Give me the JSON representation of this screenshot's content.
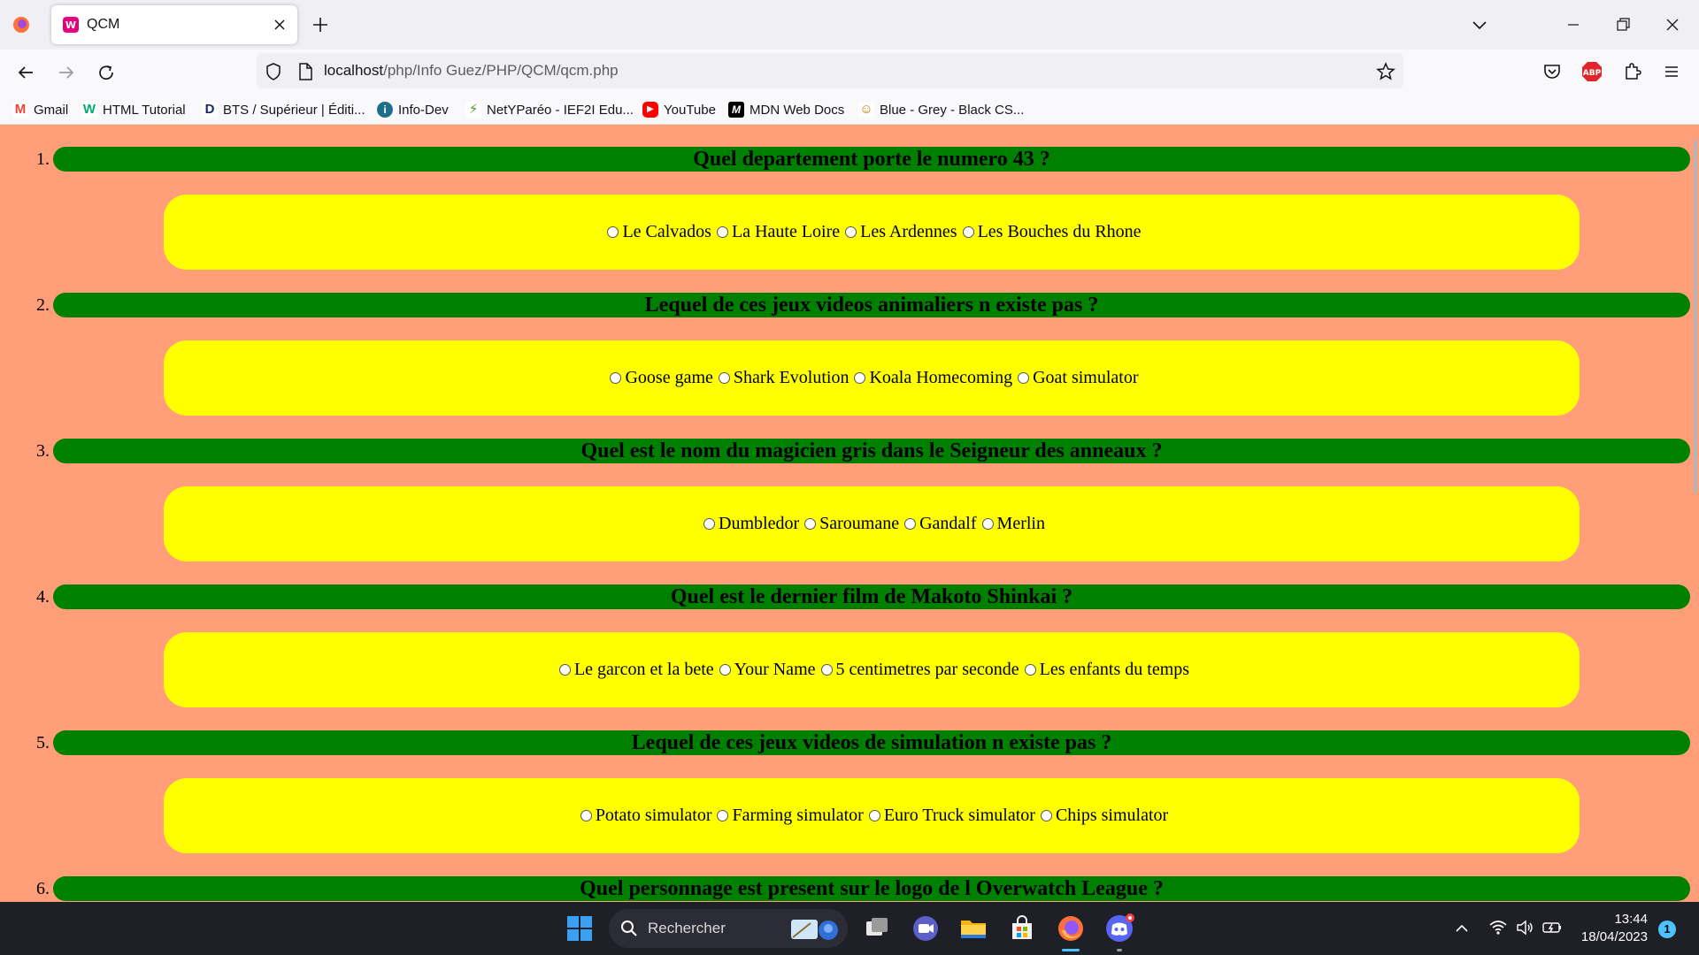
{
  "browser": {
    "tab_title": "QCM",
    "url_host": "localhost",
    "url_path": "/php/Info Guez/PHP/QCM/qcm.php",
    "bookmarks": [
      {
        "label": "Gmail",
        "icon": "gmail-icon"
      },
      {
        "label": "HTML Tutorial",
        "icon": "w3schools-icon"
      },
      {
        "label": "BTS / Supérieur | Éditi...",
        "icon": "d-logo-icon"
      },
      {
        "label": "Info-Dev",
        "icon": "info-dev-icon"
      },
      {
        "label": "NetYParéo - IEF2I Edu...",
        "icon": "netypareo-icon"
      },
      {
        "label": "YouTube",
        "icon": "youtube-icon"
      },
      {
        "label": "MDN Web Docs",
        "icon": "mdn-icon"
      },
      {
        "label": "Blue - Grey - Black CS...",
        "icon": "blue-grey-icon"
      }
    ]
  },
  "quiz": {
    "questions": [
      {
        "number": "1.",
        "text": "Quel departement porte le numero 43 ?",
        "options": [
          "Le Calvados",
          "La Haute Loire",
          "Les Ardennes",
          "Les Bouches du Rhone"
        ]
      },
      {
        "number": "2.",
        "text": "Lequel de ces jeux videos animaliers n existe pas ?",
        "options": [
          "Goose game",
          "Shark Evolution",
          "Koala Homecoming",
          "Goat simulator"
        ]
      },
      {
        "number": "3.",
        "text": "Quel est le nom du magicien gris dans le Seigneur des anneaux ?",
        "options": [
          "Dumbledor",
          "Saroumane",
          "Gandalf",
          "Merlin"
        ]
      },
      {
        "number": "4.",
        "text": "Quel est le dernier film de Makoto Shinkai ?",
        "options": [
          "Le garcon et la bete",
          "Your Name",
          "5 centimetres par seconde",
          "Les enfants du temps"
        ]
      },
      {
        "number": "5.",
        "text": "Lequel de ces jeux videos de simulation n existe pas ?",
        "options": [
          "Potato simulator",
          "Farming simulator",
          "Euro Truck simulator",
          "Chips simulator"
        ]
      },
      {
        "number": "6.",
        "text": "Quel personnage est present sur le logo de l Overwatch League ?",
        "options": []
      }
    ]
  },
  "taskbar": {
    "search_label": "Rechercher",
    "time": "13:44",
    "date": "18/04/2023",
    "notification_count": "1"
  },
  "colors": {
    "page_background": "#ff9e79",
    "question_bar": "#008000",
    "answer_box": "#ffff00"
  }
}
